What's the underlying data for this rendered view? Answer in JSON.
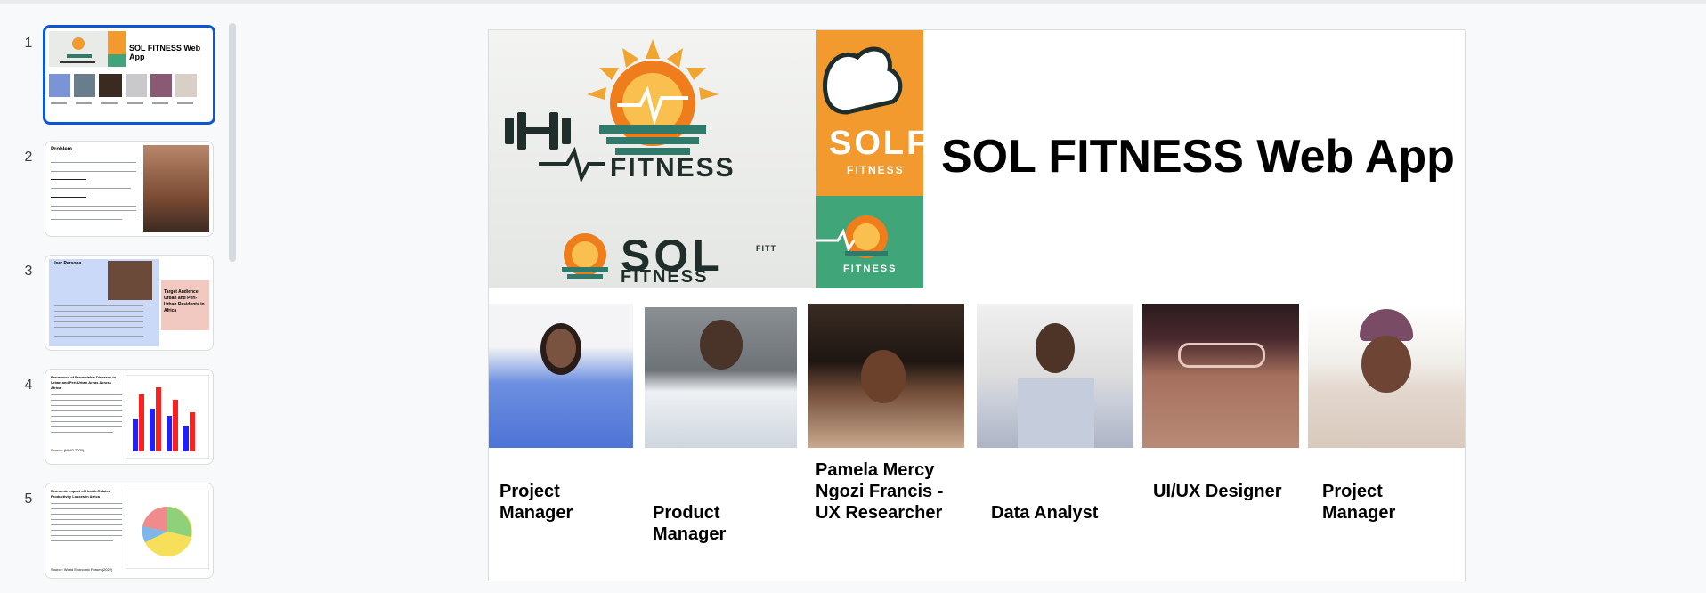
{
  "filmstrip": {
    "slides": [
      {
        "number": "1",
        "title": "SOL FITNESS Web App"
      },
      {
        "number": "2",
        "title": "Problem"
      },
      {
        "number": "3",
        "title": "User Persona",
        "side_label": "Target Audience: Urban and Peri-Urban Residents in Africa"
      },
      {
        "number": "4",
        "title": "Prevalence of Preventable Diseases in Urban and Peri-Urban Areas Across Africa",
        "source": "Source: (WHO 2020)"
      },
      {
        "number": "5",
        "title": "Economic Impact of Health-Related Productivity Losses in Africa",
        "source": "Source: World Economic Forum (2022)"
      }
    ]
  },
  "slide": {
    "title": "SOL FITNESS Web App",
    "logo": {
      "main_word": "FITNESS",
      "sol_word": "SOL",
      "sol_sub": "FITNESS",
      "fitt_word": "FITT",
      "orange_word": "SOLF",
      "orange_sub": "FITNESS",
      "green_sub": "FITNESS"
    },
    "team": [
      {
        "role": "Project Manager"
      },
      {
        "role": "Product Manager"
      },
      {
        "role": "Pamela Mercy Ngozi Francis - UX Researcher"
      },
      {
        "role": "Data Analyst"
      },
      {
        "role": "UI/UX Designer"
      },
      {
        "role": "Project Manager"
      }
    ]
  },
  "colors": {
    "selection": "#0b57d0",
    "orange": "#f39a2e",
    "green": "#41a57a"
  }
}
